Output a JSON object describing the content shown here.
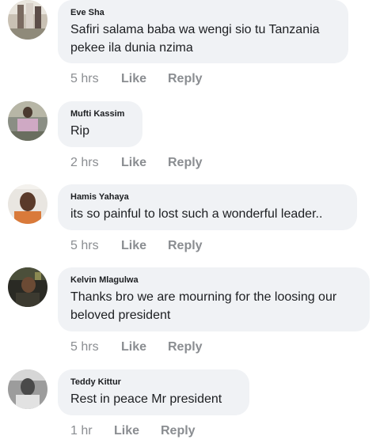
{
  "comments": [
    {
      "author": "Eve Sha",
      "text": "Safiri salama baba wa wengi sio tu Tanzania pekee ila dunia nzima",
      "time": "5 hrs",
      "like_label": "Like",
      "reply_label": "Reply"
    },
    {
      "author": "Mufti Kassim",
      "text": "Rip",
      "time": "2 hrs",
      "like_label": "Like",
      "reply_label": "Reply"
    },
    {
      "author": "Hamis Yahaya",
      "text": "its so painful to lost such a wonderful leader..",
      "time": "5 hrs",
      "like_label": "Like",
      "reply_label": "Reply"
    },
    {
      "author": "Kelvin Mlagulwa",
      "text": "Thanks bro we are mourning for the loosing our beloved president",
      "time": "5 hrs",
      "like_label": "Like",
      "reply_label": "Reply"
    },
    {
      "author": "Teddy Kittur",
      "text": "Rest in peace Mr president",
      "time": "1 hr",
      "like_label": "Like",
      "reply_label": "Reply"
    }
  ],
  "colors": {
    "bubble_bg": "#f0f2f5",
    "text": "#1c1e21",
    "meta": "#8a8d91"
  },
  "icons": {
    "avatar": "profile-photo"
  }
}
